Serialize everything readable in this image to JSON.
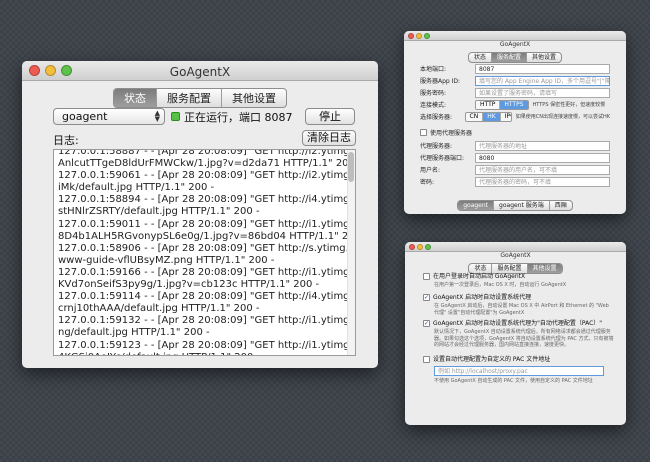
{
  "main": {
    "title": "GoAgentX",
    "tabs": [
      "状态",
      "服务配置",
      "其他设置"
    ],
    "active_tab": 0,
    "service_select": "goagent",
    "stop_button": "停止",
    "status_text": "正在运行，端口 8087",
    "status_color": "#54c244",
    "log_label": "日志:",
    "clear_log_button": "清除日志",
    "log_lines": [
      "127.0.0.1:58887 - - [Apr 28 20:08:09] \"GET http://i2.ytimg.com/vi/",
      "AnlcutTTgeD8ldUrFMWCkw/1.jpg?v=d2da71 HTTP/1.1\" 200 -",
      "127.0.0.1:59061 - - [Apr 28 20:08:09] \"GET http://i2.ytimg.com/vi/QWva0tg-",
      "iMk/default.jpg HTTP/1.1\" 200 -",
      "127.0.0.1:58894 - - [Apr 28 20:08:09] \"GET http://i4.ytimg.com/vi/",
      "stHNlrZSRTY/default.jpg HTTP/1.1\" 200 -",
      "127.0.0.1:59011 - - [Apr 28 20:08:09] \"GET http://i1.ytimg.com/i/",
      "8D4b1ALH5RGvonypSL6e0g/1.jpg?v=86bd04 HTTP/1.1\" 200 -",
      "127.0.0.1:58906 - - [Apr 28 20:08:09] \"GET http://s.ytimg.com/yt/imgbin/",
      "www-guide-vflUBsyMZ.png HTTP/1.1\" 200 -",
      "127.0.0.1:59166 - - [Apr 28 20:08:09] \"GET http://i1.ytimg.com/i/Ef_Bc-",
      "KVd7onSeifS3py9g/1.jpg?v=cb123c HTTP/1.1\" 200 -",
      "127.0.0.1:59114 - - [Apr 28 20:08:09] \"GET http://i4.ytimg.com/vi/",
      "crnj10thAAA/default.jpg HTTP/1.1\" 200 -",
      "127.0.0.1:59132 - - [Apr 28 20:08:09] \"GET http://i1.ytimg.com/vi/pPTHqu-i-",
      "ng/default.jpg HTTP/1.1\" 200 -",
      "127.0.0.1:59123 - - [Apr 28 20:08:09] \"GET http://i1.ytimg.com/vi/",
      "4KGSi0AoJYs/default.jpg HTTP/1.1\" 200 -",
      "127.0.0.1:59093 - - [Apr 28 20:08:09] \"GE"
    ]
  },
  "config": {
    "title": "GoAgentX",
    "tabs": [
      "状态",
      "服务配置",
      "其他设置"
    ],
    "active_tab": 1,
    "local_port_label": "本地端口:",
    "local_port_value": "8087",
    "appid_label": "服务器App ID:",
    "appid_placeholder": "填写您的 App Engine App ID，多个用逗号\"|\"隔开",
    "password_label": "服务密码:",
    "password_placeholder": "如果设置了服务密码，请填写",
    "mode_label": "连接模式:",
    "mode_options": [
      "HTTP",
      "HTTPS"
    ],
    "mode_note": "HTTPS 保密性更好，但速度较慢",
    "server_label": "选择服务器:",
    "server_options": [
      "CN",
      "HK",
      "IPv6"
    ],
    "server_note": "如果使用CN出现连接速度慢，可以尝试HK",
    "proxy_checkbox": "使用代理服务器",
    "proxy_server_label": "代理服务器:",
    "proxy_server_placeholder": "代理服务器的地址",
    "proxy_port_label": "代理服务器端口:",
    "proxy_port_value": "8080",
    "username_label": "用户名:",
    "username_placeholder": "代理服务器的用户名，可不填",
    "pwd_label": "密码:",
    "pwd_placeholder": "代理服务器的密码，可不填",
    "bottom_tabs": [
      "goagent",
      "goagent 服务端",
      "西厢"
    ]
  },
  "prefs": {
    "title": "GoAgentX",
    "tabs": [
      "状态",
      "服务配置",
      "其他设置"
    ],
    "active_tab": 2,
    "opt1_title": "在用户登录时自动启动 GoAgentX",
    "opt1_desc": "在用户第一次登录后，Mac OS X 时，自动运行 GoAgentX",
    "opt2_title": "GoAgentX 启动时自动设置系统代理",
    "opt2_desc": "在 GoAgentX 启动后，自动设置 Mac OS X 中 AirPort 和 Ethernet 的 \"Web 代理\" 设置\"自动代理配置\"为 GoAgentX",
    "opt3_title": "GoAgentX 启动时自动设置系统代理为\"自动代理配置（PAC）\"",
    "opt3_desc": "默认情况下，GoAgentX 自动设置系统代理后，所有网络请求都会通过代理服务器。如果勾选这个选项，GoAgentX 将自动设置系统代理为 PAC 方式，只有被墙的网站才会经过代理服务器，国内网站直接连接，速度更快。",
    "opt4_title": "设置自动代理配置为自定义的 PAC 文件地址",
    "opt4_placeholder": "例如 http://localhost/proxy.pac",
    "opt4_desc": "不使用 GoAgentX 自动生成的 PAC 文件，使用自定义的 PAC 文件地址"
  }
}
